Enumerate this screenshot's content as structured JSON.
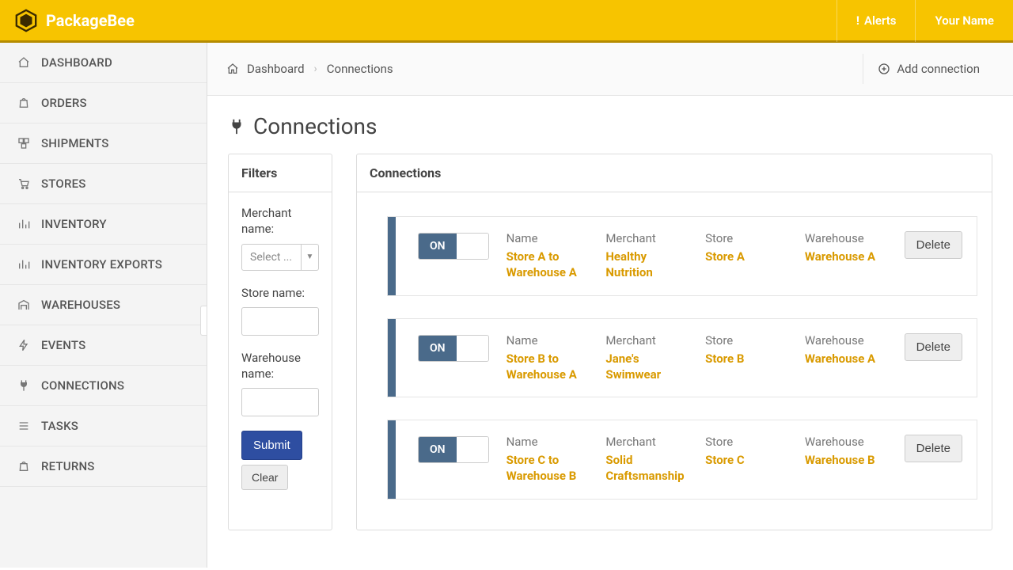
{
  "brand": "PackageBee",
  "topbar": {
    "alerts": "Alerts",
    "user": "Your Name"
  },
  "nav": [
    {
      "label": "DASHBOARD",
      "icon": "home"
    },
    {
      "label": "ORDERS",
      "icon": "bag"
    },
    {
      "label": "SHIPMENTS",
      "icon": "boxes"
    },
    {
      "label": "STORES",
      "icon": "cart"
    },
    {
      "label": "INVENTORY",
      "icon": "bars"
    },
    {
      "label": "INVENTORY EXPORTS",
      "icon": "bars"
    },
    {
      "label": "WAREHOUSES",
      "icon": "warehouse"
    },
    {
      "label": "EVENTS",
      "icon": "bolt"
    },
    {
      "label": "CONNECTIONS",
      "icon": "plug"
    },
    {
      "label": "TASKS",
      "icon": "list"
    },
    {
      "label": "RETURNS",
      "icon": "bag"
    }
  ],
  "breadcrumb": {
    "items": [
      "Dashboard",
      "Connections"
    ],
    "action": "Add connection"
  },
  "page_title": "Connections",
  "filters": {
    "title": "Filters",
    "merchant_label": "Merchant name:",
    "merchant_placeholder": "Select ...",
    "store_label": "Store name:",
    "warehouse_label": "Warehouse name:",
    "submit": "Submit",
    "clear": "Clear"
  },
  "connections": {
    "title": "Connections",
    "headers": {
      "name": "Name",
      "merchant": "Merchant",
      "store": "Store",
      "warehouse": "Warehouse"
    },
    "toggle_on": "ON",
    "delete": "Delete",
    "rows": [
      {
        "name": "Store A to Warehouse A",
        "merchant": "Healthy Nutrition",
        "store": "Store A",
        "warehouse": "Warehouse A"
      },
      {
        "name": "Store B to Warehouse A",
        "merchant": "Jane's Swimwear",
        "store": "Store B",
        "warehouse": "Warehouse A"
      },
      {
        "name": "Store C to Warehouse B",
        "merchant": "Solid Craftsmanship",
        "store": "Store C",
        "warehouse": "Warehouse B"
      }
    ]
  }
}
